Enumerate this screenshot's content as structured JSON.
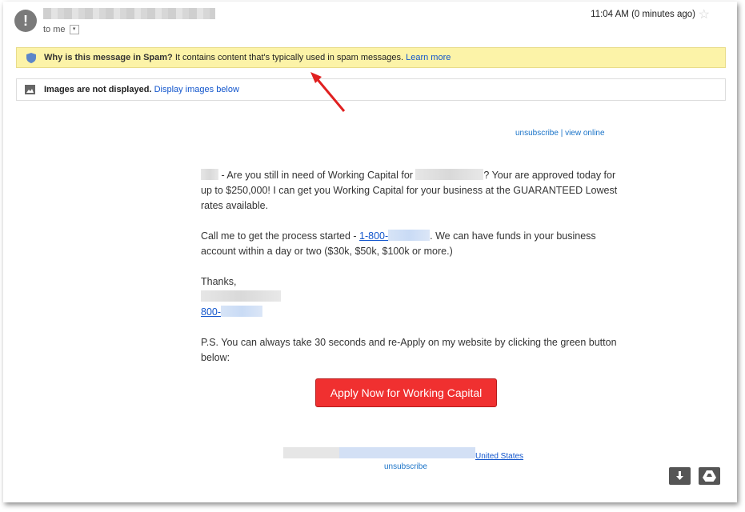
{
  "header": {
    "avatar_glyph": "!",
    "to_label": "to me",
    "dropdown_glyph": "▾",
    "time": "11:04 AM (0 minutes ago)",
    "star_glyph": "☆"
  },
  "spam_banner": {
    "bold": "Why is this message in Spam?",
    "text": " It contains content that's typically used in spam messages. ",
    "link": "Learn more",
    "icon": "shield-icon"
  },
  "images_banner": {
    "bold": "Images are not displayed.",
    "link": "Display images below",
    "icon": "image-icon"
  },
  "email": {
    "top_links": "unsubscribe | view online",
    "p1_a": " - Are you still in need of Working Capital for ",
    "p1_b": "?  Your are approved today for up to $250,000!  I can get you Working Capital for your business at the GUARANTEED Lowest rates available.",
    "p2_a": "Call me to get the process started - ",
    "p2_phone": "1-800-",
    "p2_b": ". We can have funds in your business account within a day or two ($30k, $50k, $100k or more.)",
    "p3_thanks": "Thanks,",
    "p3_phone": "800-",
    "p4": "P.S. You can always take 30 seconds and re-Apply on my website by clicking the green button below:",
    "cta_label": "Apply Now for Working Capital",
    "footer_country": "United States",
    "footer_unsub": "unsubscribe"
  },
  "actions": {
    "download_icon": "download-icon",
    "drive_icon": "google-drive-icon"
  },
  "colors": {
    "spam_banner_bg": "#fcf3a8",
    "cta_bg": "#f03030",
    "link": "#1155cc",
    "annotation_arrow": "#e02020"
  }
}
